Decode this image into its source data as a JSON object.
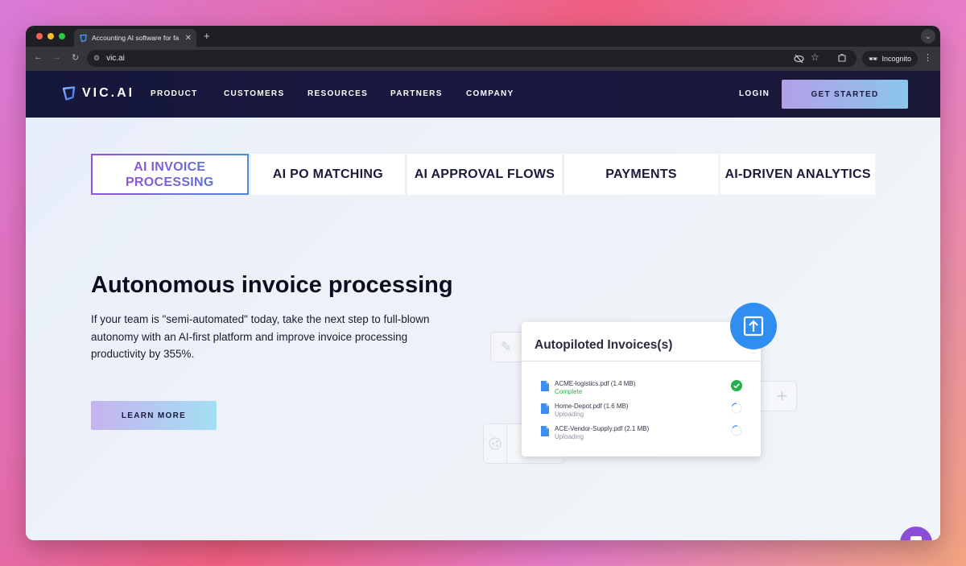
{
  "browser": {
    "tab_title": "Accounting AI software for fa",
    "url": "vic.ai",
    "incognito_label": "Incognito"
  },
  "site": {
    "logo_text": "VIC.AI",
    "nav": [
      "PRODUCT",
      "CUSTOMERS",
      "RESOURCES",
      "PARTNERS",
      "COMPANY"
    ],
    "login": "LOGIN",
    "cta": "GET STARTED"
  },
  "feature_tabs": {
    "items": [
      {
        "label": "AI INVOICE PROCESSING",
        "active": true
      },
      {
        "label": "AI PO MATCHING",
        "active": false
      },
      {
        "label": "AI APPROVAL FLOWS",
        "active": false
      },
      {
        "label": "PAYMENTS",
        "active": false
      },
      {
        "label": "AI-DRIVEN ANALYTICS",
        "active": false
      }
    ]
  },
  "hero": {
    "title": "Autonomous invoice processing",
    "body": "If your team is \"semi-automated\" today, take the next step to full-blown autonomy with an AI-first platform and improve invoice processing productivity by 355%.",
    "button": "LEARN MORE"
  },
  "invoice_card": {
    "title": "Autopiloted Invoices(s)",
    "files": [
      {
        "name": "ACME-logistics.pdf (1.4 MB)",
        "status": "Complete"
      },
      {
        "name": "Home-Depot.pdf (1.6 MB)",
        "status": "Uploading"
      },
      {
        "name": "ACE-Vendor-Supply.pdf (2.1 MB)",
        "status": "Uploading"
      }
    ]
  },
  "colors": {
    "nav_bg": "#15173a",
    "accent_purple": "#7b4fe0",
    "upload_blue": "#2f8ef0",
    "complete_green": "#22b14c",
    "chat_purple": "#8a4dd8"
  }
}
